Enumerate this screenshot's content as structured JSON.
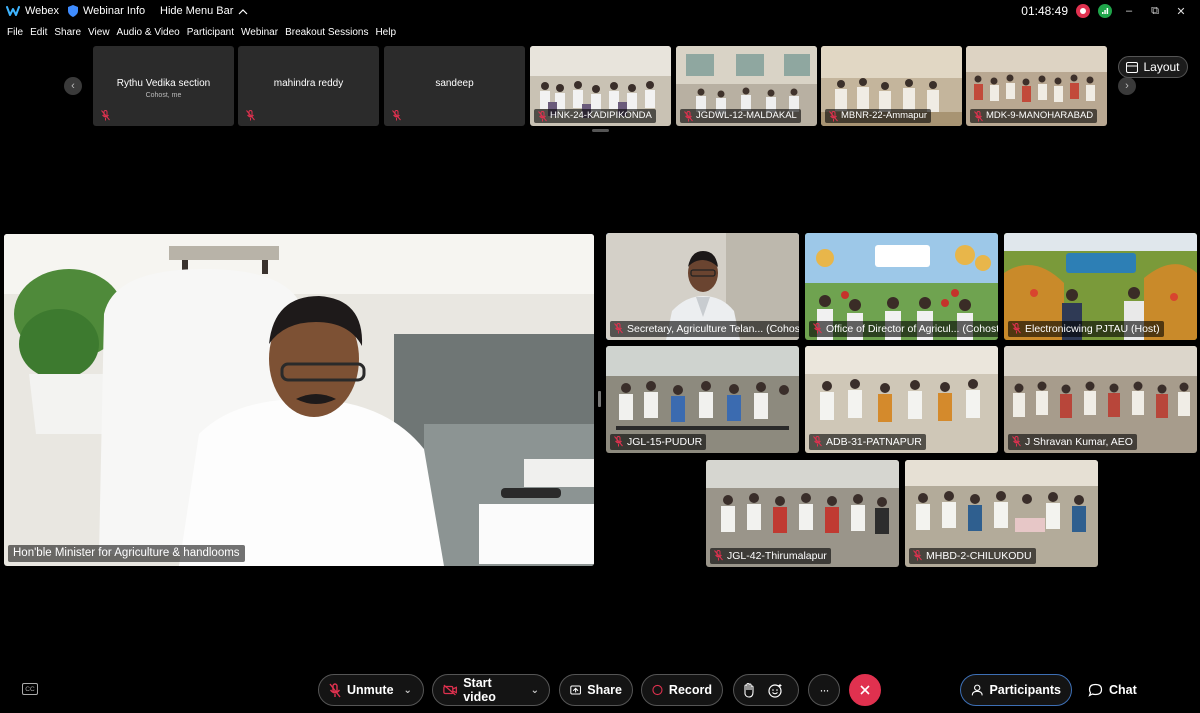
{
  "titlebar": {
    "app_name": "Webex",
    "webinar_info": "Webinar Info",
    "hide_menu_bar": "Hide Menu Bar",
    "time": "01:48:49",
    "restore_glyph": "⧉",
    "minimize_glyph": "–",
    "close_glyph": "✕"
  },
  "menu": [
    "File",
    "Edit",
    "Share",
    "View",
    "Audio & Video",
    "Participant",
    "Webinar",
    "Breakout Sessions",
    "Help"
  ],
  "filmstrip": {
    "prev_glyph": "‹",
    "next_glyph": "›",
    "name_tiles": [
      {
        "name": "Rythu Vedika section",
        "sub": "Cohost, me"
      },
      {
        "name": "mahindra reddy",
        "sub": ""
      },
      {
        "name": "sandeep",
        "sub": ""
      }
    ],
    "video_tiles": [
      {
        "label": "HNK-24-KADIPIKONDA"
      },
      {
        "label": "JGDWL-12-MALDAKAL"
      },
      {
        "label": "MBNR-22-Ammapur"
      },
      {
        "label": "MDK-9-MANOHARABAD"
      }
    ]
  },
  "layout_button": "Layout",
  "main_speaker": {
    "label": "Hon'ble Minister for Agriculture & handlooms"
  },
  "grid": [
    {
      "label": "Secretary, Agriculture Telan... (Cohost)",
      "active": true
    },
    {
      "label": "Office of Director of Agricul... (Cohost)",
      "active": false
    },
    {
      "label": "Electronicwing PJTAU (Host)",
      "active": false
    },
    {
      "label": "JGL-15-PUDUR",
      "active": false
    },
    {
      "label": "ADB-31-PATNAPUR",
      "active": false
    },
    {
      "label": "J Shravan Kumar, AEO",
      "active": false
    },
    {
      "label": "JGL-42-Thirumalapur",
      "active": false
    },
    {
      "label": "MHBD-2-CHILUKODU",
      "active": false
    }
  ],
  "controls": {
    "cc": "CC",
    "unmute": "Unmute",
    "start_video": "Start video",
    "share": "Share",
    "record": "Record",
    "more": "···",
    "participants": "Participants",
    "chat": "Chat"
  },
  "colors": {
    "accent_blue": "#4aa3ff",
    "end_red": "#e0314f",
    "recording_red": "#e0314f",
    "network_green": "#1fa54a"
  }
}
